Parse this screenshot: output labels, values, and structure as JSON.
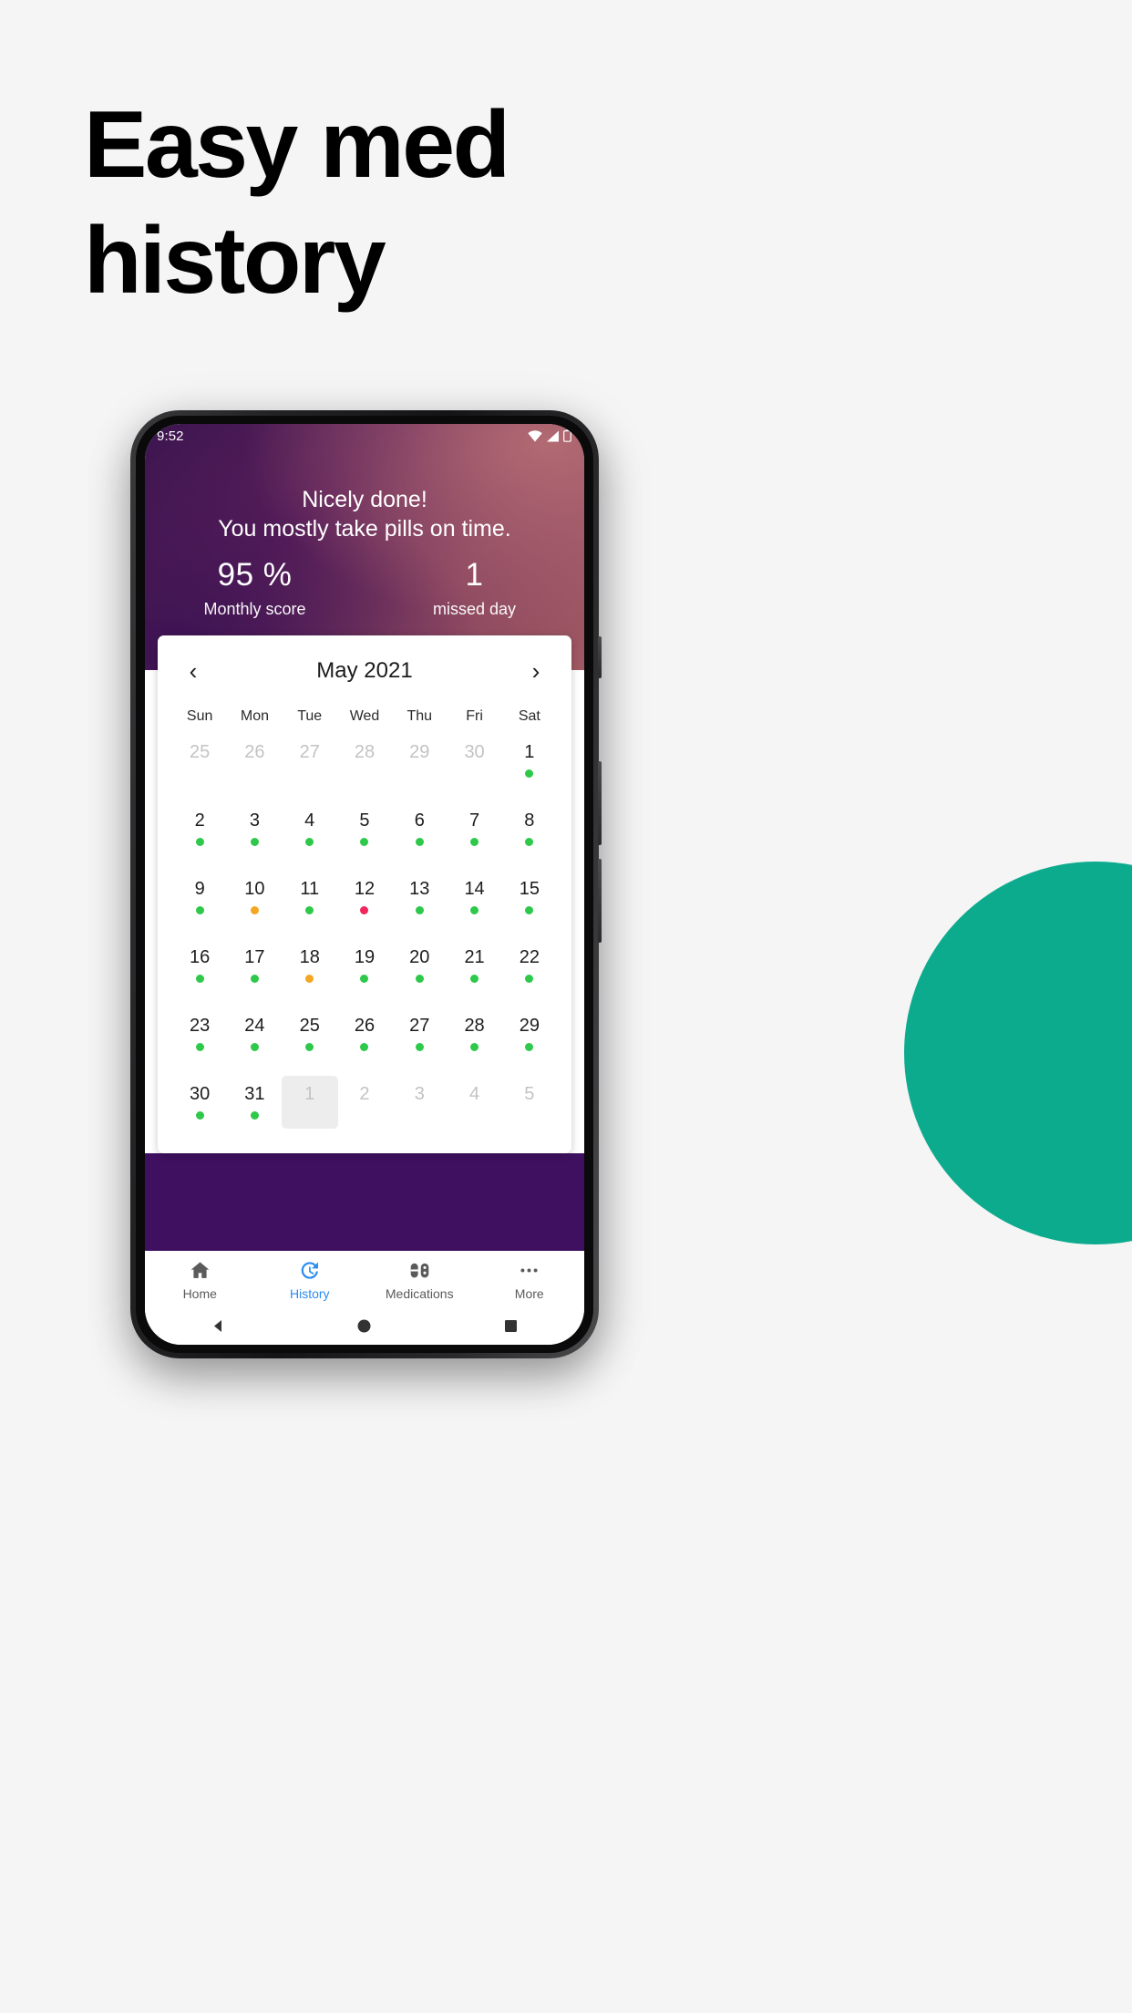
{
  "promo": {
    "headline_lines": [
      "Easy med",
      "history"
    ],
    "background_color": "#f5f5f5",
    "accent_circle_color": "#0dab8e"
  },
  "statusbar": {
    "time": "9:52",
    "icons": [
      "wifi-icon",
      "cellular-signal-icon",
      "battery-icon"
    ]
  },
  "hero": {
    "title": "Nicely done!",
    "subtitle": "You mostly take pills on time.",
    "stats": [
      {
        "value": "95 %",
        "label": "Monthly score"
      },
      {
        "value": "1",
        "label": "missed day"
      }
    ]
  },
  "calendar": {
    "prev_label": "‹",
    "next_label": "›",
    "title": "May 2021",
    "weekdays": [
      "Sun",
      "Mon",
      "Tue",
      "Wed",
      "Thu",
      "Fri",
      "Sat"
    ],
    "dot_colors": {
      "taken": "#2ec84a",
      "late": "#f5a623",
      "missed": "#f0275c"
    },
    "weeks": [
      [
        {
          "day": "25",
          "muted": true,
          "dot": null
        },
        {
          "day": "26",
          "muted": true,
          "dot": null
        },
        {
          "day": "27",
          "muted": true,
          "dot": null
        },
        {
          "day": "28",
          "muted": true,
          "dot": null
        },
        {
          "day": "29",
          "muted": true,
          "dot": null
        },
        {
          "day": "30",
          "muted": true,
          "dot": null
        },
        {
          "day": "1",
          "muted": false,
          "dot": "taken"
        }
      ],
      [
        {
          "day": "2",
          "muted": false,
          "dot": "taken"
        },
        {
          "day": "3",
          "muted": false,
          "dot": "taken"
        },
        {
          "day": "4",
          "muted": false,
          "dot": "taken"
        },
        {
          "day": "5",
          "muted": false,
          "dot": "taken"
        },
        {
          "day": "6",
          "muted": false,
          "dot": "taken"
        },
        {
          "day": "7",
          "muted": false,
          "dot": "taken"
        },
        {
          "day": "8",
          "muted": false,
          "dot": "taken"
        }
      ],
      [
        {
          "day": "9",
          "muted": false,
          "dot": "taken"
        },
        {
          "day": "10",
          "muted": false,
          "dot": "late"
        },
        {
          "day": "11",
          "muted": false,
          "dot": "taken"
        },
        {
          "day": "12",
          "muted": false,
          "dot": "missed"
        },
        {
          "day": "13",
          "muted": false,
          "dot": "taken"
        },
        {
          "day": "14",
          "muted": false,
          "dot": "taken"
        },
        {
          "day": "15",
          "muted": false,
          "dot": "taken"
        }
      ],
      [
        {
          "day": "16",
          "muted": false,
          "dot": "taken"
        },
        {
          "day": "17",
          "muted": false,
          "dot": "taken"
        },
        {
          "day": "18",
          "muted": false,
          "dot": "late"
        },
        {
          "day": "19",
          "muted": false,
          "dot": "taken"
        },
        {
          "day": "20",
          "muted": false,
          "dot": "taken"
        },
        {
          "day": "21",
          "muted": false,
          "dot": "taken"
        },
        {
          "day": "22",
          "muted": false,
          "dot": "taken"
        }
      ],
      [
        {
          "day": "23",
          "muted": false,
          "dot": "taken"
        },
        {
          "day": "24",
          "muted": false,
          "dot": "taken"
        },
        {
          "day": "25",
          "muted": false,
          "dot": "taken"
        },
        {
          "day": "26",
          "muted": false,
          "dot": "taken"
        },
        {
          "day": "27",
          "muted": false,
          "dot": "taken"
        },
        {
          "day": "28",
          "muted": false,
          "dot": "taken"
        },
        {
          "day": "29",
          "muted": false,
          "dot": "taken"
        }
      ],
      [
        {
          "day": "30",
          "muted": false,
          "dot": "taken"
        },
        {
          "day": "31",
          "muted": false,
          "dot": "taken"
        },
        {
          "day": "1",
          "muted": true,
          "dot": null,
          "selected": true
        },
        {
          "day": "2",
          "muted": true,
          "dot": null
        },
        {
          "day": "3",
          "muted": true,
          "dot": null
        },
        {
          "day": "4",
          "muted": true,
          "dot": null
        },
        {
          "day": "5",
          "muted": true,
          "dot": null
        }
      ]
    ]
  },
  "bottomnav": {
    "active_color": "#2b8cf0",
    "items": [
      {
        "label": "Home",
        "icon": "home-icon",
        "active": false
      },
      {
        "label": "History",
        "icon": "history-clock-icon",
        "active": true
      },
      {
        "label": "Medications",
        "icon": "pills-icon",
        "active": false
      },
      {
        "label": "More",
        "icon": "more-dots-icon",
        "active": false
      }
    ]
  },
  "sysbar": {
    "buttons": [
      "back-triangle-icon",
      "home-circle-icon",
      "recents-square-icon"
    ]
  }
}
